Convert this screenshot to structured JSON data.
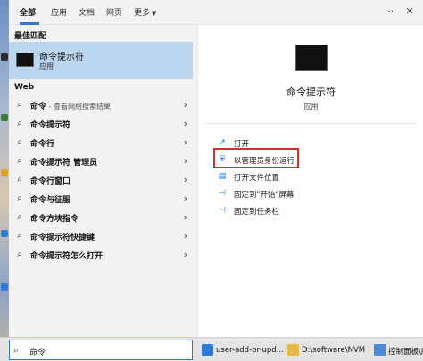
{
  "tabs": {
    "all": "全部",
    "apps": "应用",
    "documents": "文档",
    "web": "网页",
    "more": "更多"
  },
  "left": {
    "best_match_header": "最佳匹配",
    "best_match": {
      "title": "命令提示符",
      "subtitle": "应用"
    },
    "web_header": "Web",
    "web_results": [
      {
        "bold": "命令",
        "rest": " - 查看网络搜索结果",
        "icon": "search-icon"
      },
      {
        "bold": "命令提示符",
        "rest": "",
        "icon": "search-icon"
      },
      {
        "bold": "命令行",
        "rest": "",
        "icon": "search-icon"
      },
      {
        "bold": "命令提示符 管理员",
        "rest": "",
        "icon": "search-icon"
      },
      {
        "bold": "命令行窗口",
        "rest": "",
        "icon": "search-icon"
      },
      {
        "bold": "命令与征服",
        "rest": "",
        "icon": "search-icon"
      },
      {
        "bold": "命令方块指令",
        "rest": "",
        "icon": "search-icon"
      },
      {
        "bold": "命令提示符快捷键",
        "rest": "",
        "icon": "search-icon"
      },
      {
        "bold": "命令提示符怎么打开",
        "rest": "",
        "icon": "search-icon"
      }
    ]
  },
  "right": {
    "title": "命令提示符",
    "subtitle": "应用",
    "actions": [
      {
        "label": "打开",
        "icon": "open-icon"
      },
      {
        "label": "以管理员身份运行",
        "icon": "run-as-admin-icon"
      },
      {
        "label": "打开文件位置",
        "icon": "file-location-icon"
      },
      {
        "label": "固定到\"开始\"屏幕",
        "icon": "pin-start-icon"
      },
      {
        "label": "固定到任务栏",
        "icon": "pin-taskbar-icon"
      }
    ]
  },
  "taskbar": {
    "search_value": "命令",
    "items": [
      {
        "label": "user-add-or-upd...",
        "icon": "vscode-icon"
      },
      {
        "label": "D:\\software\\NVM",
        "icon": "folder-icon"
      },
      {
        "label": "控制面板\\所",
        "icon": "control-panel-icon"
      }
    ]
  },
  "colors": {
    "accent": "#3178c6",
    "best_match_bg": "#bcd6ef",
    "highlight": "#d23030"
  }
}
